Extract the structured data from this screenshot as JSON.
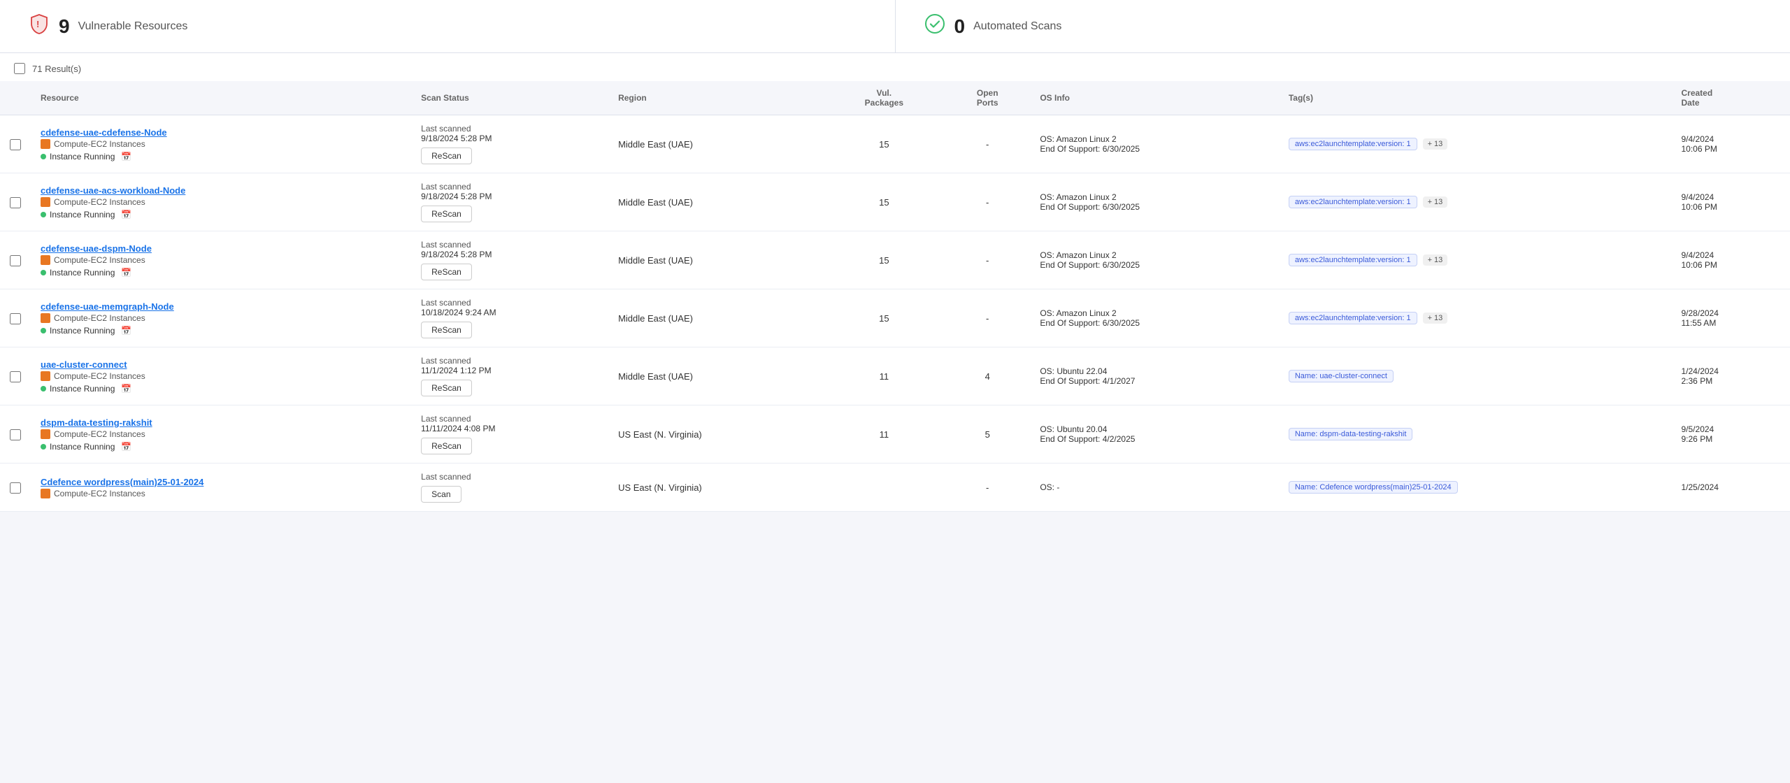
{
  "header": {
    "vulnerable_resources": {
      "icon": "🛡",
      "count": "9",
      "label": "Vulnerable Resources"
    },
    "automated_scans": {
      "icon": "✅",
      "count": "0",
      "label": "Automated Scans"
    }
  },
  "results": {
    "count_text": "71 Result(s)"
  },
  "table": {
    "columns": [
      "Resource",
      "Scan Status",
      "Region",
      "Vul. Packages",
      "Open Ports",
      "OS Info",
      "Tag(s)",
      "Created Date"
    ],
    "rows": [
      {
        "resource_name": "cdefense-uae-cdefense-Node",
        "resource_type": "Compute-EC2 Instances",
        "status": "Instance Running",
        "scan_label": "Last scanned",
        "scan_date": "9/18/2024 5:28 PM",
        "rescan": "ReScan",
        "region": "Middle East (UAE)",
        "vul_packages": "15",
        "open_ports": "-",
        "os_label": "OS:",
        "os_value": "Amazon Linux 2",
        "eos_label": "End Of Support:",
        "eos_value": "6/30/2025",
        "tag_main": "aws:ec2launchtemplate:version: 1",
        "tag_more": "+ 13",
        "created_date": "9/4/2024",
        "created_time": "10:06 PM"
      },
      {
        "resource_name": "cdefense-uae-acs-workload-Node",
        "resource_type": "Compute-EC2 Instances",
        "status": "Instance Running",
        "scan_label": "Last scanned",
        "scan_date": "9/18/2024 5:28 PM",
        "rescan": "ReScan",
        "region": "Middle East (UAE)",
        "vul_packages": "15",
        "open_ports": "-",
        "os_label": "OS:",
        "os_value": "Amazon Linux 2",
        "eos_label": "End Of Support:",
        "eos_value": "6/30/2025",
        "tag_main": "aws:ec2launchtemplate:version: 1",
        "tag_more": "+ 13",
        "created_date": "9/4/2024",
        "created_time": "10:06 PM"
      },
      {
        "resource_name": "cdefense-uae-dspm-Node",
        "resource_type": "Compute-EC2 Instances",
        "status": "Instance Running",
        "scan_label": "Last scanned",
        "scan_date": "9/18/2024 5:28 PM",
        "rescan": "ReScan",
        "region": "Middle East (UAE)",
        "vul_packages": "15",
        "open_ports": "-",
        "os_label": "OS:",
        "os_value": "Amazon Linux 2",
        "eos_label": "End Of Support:",
        "eos_value": "6/30/2025",
        "tag_main": "aws:ec2launchtemplate:version: 1",
        "tag_more": "+ 13",
        "created_date": "9/4/2024",
        "created_time": "10:06 PM"
      },
      {
        "resource_name": "cdefense-uae-memgraph-Node",
        "resource_type": "Compute-EC2 Instances",
        "status": "Instance Running",
        "scan_label": "Last scanned",
        "scan_date": "10/18/2024 9:24 AM",
        "rescan": "ReScan",
        "region": "Middle East (UAE)",
        "vul_packages": "15",
        "open_ports": "-",
        "os_label": "OS:",
        "os_value": "Amazon Linux 2",
        "eos_label": "End Of Support:",
        "eos_value": "6/30/2025",
        "tag_main": "aws:ec2launchtemplate:version: 1",
        "tag_more": "+ 13",
        "created_date": "9/28/2024",
        "created_time": "11:55 AM"
      },
      {
        "resource_name": "uae-cluster-connect",
        "resource_type": "Compute-EC2 Instances",
        "status": "Instance Running",
        "scan_label": "Last scanned",
        "scan_date": "11/1/2024 1:12 PM",
        "rescan": "ReScan",
        "region": "Middle East (UAE)",
        "vul_packages": "11",
        "open_ports": "4",
        "os_label": "OS:",
        "os_value": "Ubuntu 22.04",
        "eos_label": "End Of Support:",
        "eos_value": "4/1/2027",
        "tag_main": "Name: uae-cluster-connect",
        "tag_more": "",
        "created_date": "1/24/2024",
        "created_time": "2:36 PM"
      },
      {
        "resource_name": "dspm-data-testing-rakshit",
        "resource_type": "Compute-EC2 Instances",
        "status": "Instance Running",
        "scan_label": "Last scanned",
        "scan_date": "11/11/2024 4:08 PM",
        "rescan": "ReScan",
        "region": "US East (N. Virginia)",
        "vul_packages": "11",
        "open_ports": "5",
        "os_label": "OS:",
        "os_value": "Ubuntu 20.04",
        "eos_label": "End Of Support:",
        "eos_value": "4/2/2025",
        "tag_main": "Name: dspm-data-testing-rakshit",
        "tag_more": "",
        "created_date": "9/5/2024",
        "created_time": "9:26 PM"
      },
      {
        "resource_name": "Cdefence wordpress(main)25-01-2024",
        "resource_type": "Compute-EC2 Instances",
        "status": "",
        "scan_label": "Last scanned",
        "scan_date": "",
        "rescan": "Scan",
        "region": "US East (N. Virginia)",
        "vul_packages": "",
        "open_ports": "",
        "os_label": "OS:",
        "os_value": "-",
        "eos_label": "",
        "eos_value": "",
        "tag_main": "Name: Cdefence wordpress(main)25-01-2024",
        "tag_more": "",
        "created_date": "1/25/2024",
        "created_time": ""
      }
    ]
  }
}
